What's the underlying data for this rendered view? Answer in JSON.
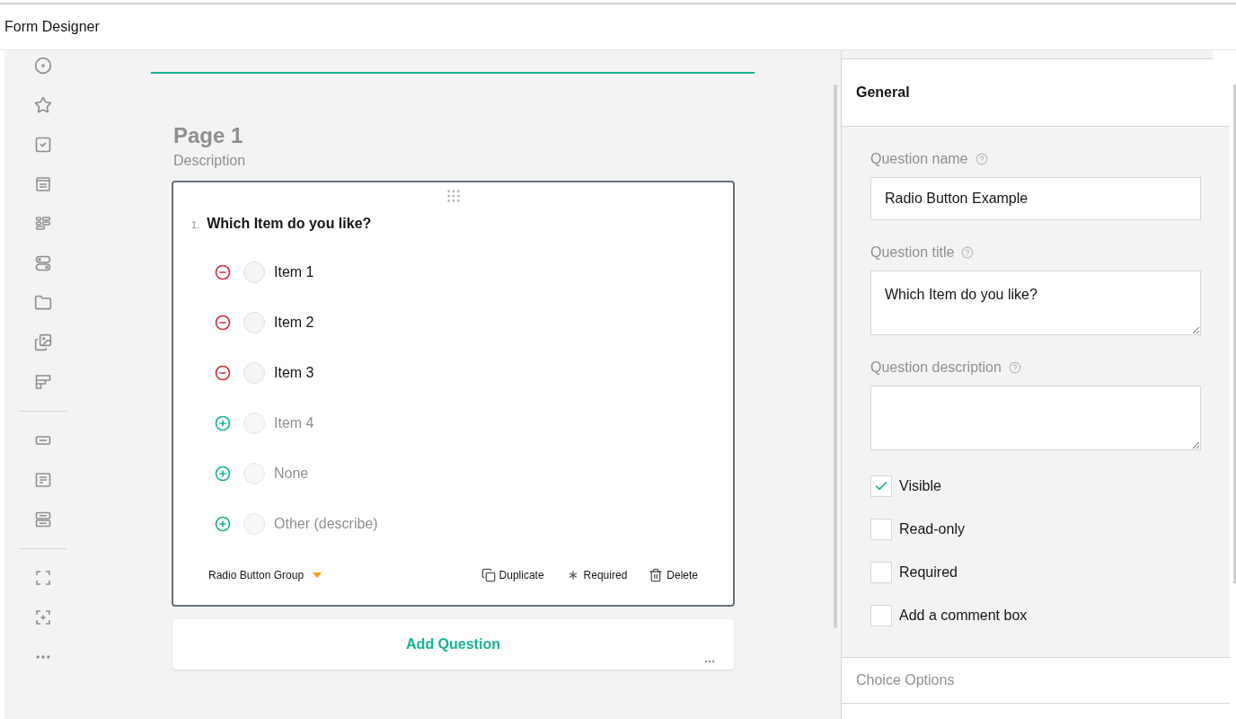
{
  "window": {
    "title": "Form Designer"
  },
  "page": {
    "title": "Page 1",
    "description": "Description"
  },
  "question": {
    "number": "1.",
    "title": "Which Item do you like?",
    "choices": [
      {
        "label": "Item 1",
        "kind": "existing",
        "selected": false
      },
      {
        "label": "Item 2",
        "kind": "existing",
        "selected": false
      },
      {
        "label": "Item 3",
        "kind": "existing",
        "selected": false
      },
      {
        "label": "Item 4",
        "kind": "extra",
        "selected": false
      },
      {
        "label": "None",
        "kind": "extra",
        "selected": false
      },
      {
        "label": "Other (describe)",
        "kind": "extra",
        "selected": false
      }
    ],
    "type_label": "Radio Button Group",
    "actions": [
      {
        "label": "Duplicate",
        "kind": "duplicate"
      },
      {
        "label": "Required",
        "kind": "required"
      },
      {
        "label": "Delete",
        "kind": "delete"
      }
    ]
  },
  "add_question": "Add Question",
  "properties": {
    "section": "General",
    "fields": [
      {
        "label": "Question name",
        "value": "Radio Button Example",
        "kind": "input"
      },
      {
        "label": "Question title",
        "value": "Which Item do you like?",
        "kind": "textarea"
      },
      {
        "label": "Question description",
        "kind": "textarea"
      }
    ],
    "checkboxes": [
      {
        "label": "Visible",
        "checked": true
      },
      {
        "label": "Read-only",
        "checked": false
      },
      {
        "label": "Required",
        "checked": false
      },
      {
        "label": "Add a comment box",
        "checked": false
      }
    ],
    "next_section": "Choice Options"
  }
}
